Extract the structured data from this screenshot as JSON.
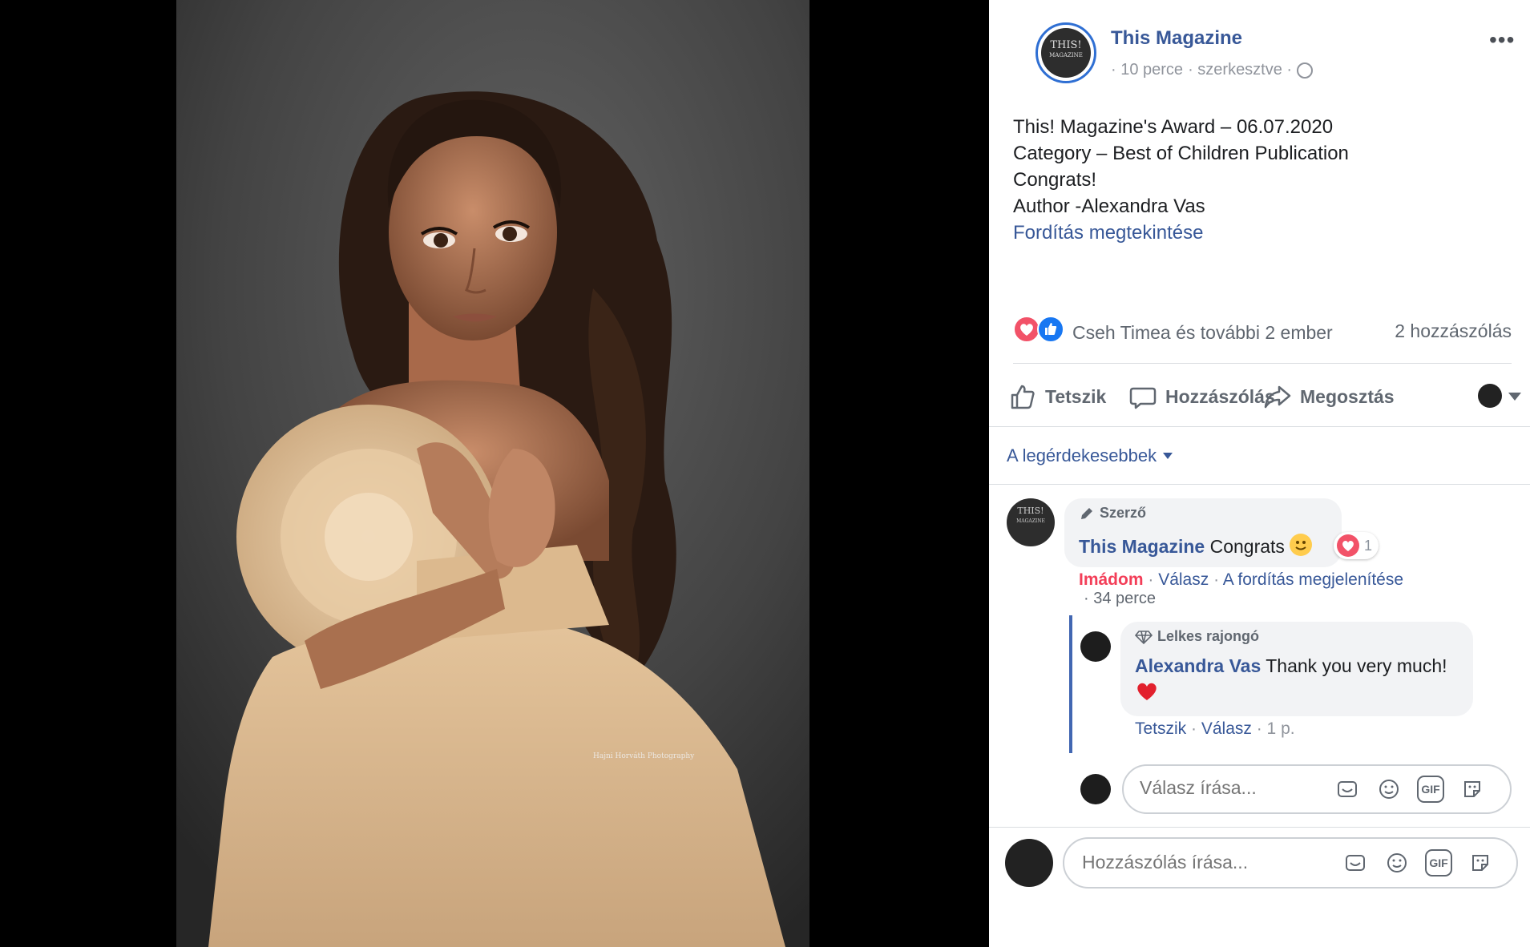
{
  "post": {
    "page_name": "This Magazine",
    "avatar_text_top": "THIS!",
    "avatar_text_bottom": "MAGAZINE",
    "time": "· 10 perce",
    "edited": "· szerkesztve ·",
    "more_label": "•••",
    "lines": [
      "This! Magazine's Award – 06.07.2020",
      "Category – Best of Children Publication",
      "Congrats!",
      "Author -Alexandra Vas"
    ],
    "translate_link": "Fordítás megtekintése"
  },
  "reactions": {
    "names": "Cseh Timea és további 2 ember",
    "comment_count": "2 hozzászólás"
  },
  "actions": {
    "like": "Tetszik",
    "comment": "Hozzászólás",
    "share": "Megosztás"
  },
  "sort": {
    "label": "A legérdekesebbek"
  },
  "comments": [
    {
      "badge": "Szerző",
      "name": "This Magazine",
      "text": "Congrats",
      "reaction_count": "1",
      "love_label": "Imádom",
      "reply_label": "Válasz",
      "translate_label": "A fordítás megjelenítése",
      "time": "· 34 perce"
    },
    {
      "badge": "Lelkes rajongó",
      "name": "Alexandra Vas",
      "text": "Thank you very much!",
      "like_label": "Tetszik",
      "reply_label": "Válasz",
      "time": "· 1 p."
    }
  ],
  "reply_input": {
    "placeholder": "Válasz írása..."
  },
  "comment_input": {
    "placeholder": "Hozzászólás írása..."
  },
  "icons": {
    "gif": "GIF",
    "colors": {
      "link": "#385898",
      "love": "#f25268",
      "like": "#1877f2",
      "reply_line": "#4267b2"
    }
  }
}
